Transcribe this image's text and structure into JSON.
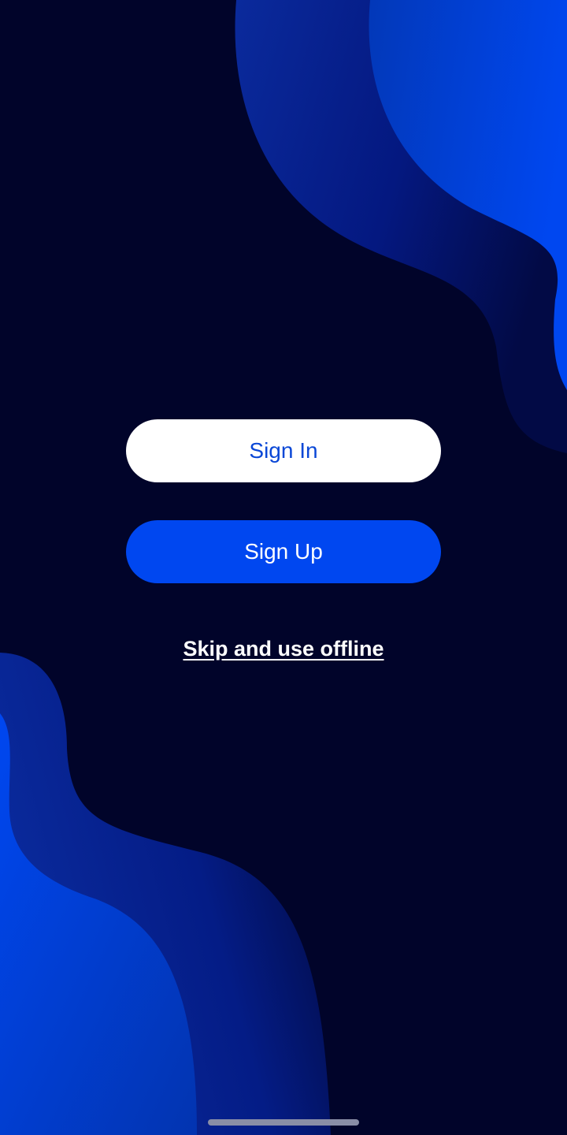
{
  "auth": {
    "sign_in_label": "Sign In",
    "sign_up_label": "Sign Up",
    "skip_label": "Skip and use offline"
  },
  "colors": {
    "background": "#01042a",
    "accent": "#0047f0",
    "sign_in_text": "#0a47d6",
    "button_light": "#ffffff"
  }
}
